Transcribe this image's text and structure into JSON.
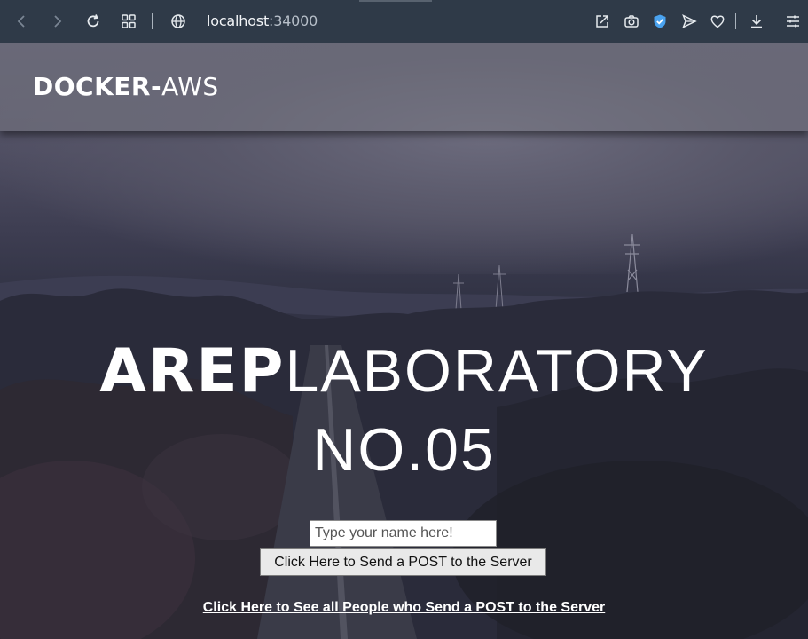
{
  "browser": {
    "url_host": "localhost",
    "url_port": ":34000",
    "icons": [
      "back-icon",
      "forward-icon",
      "reload-icon",
      "tabs-grid-icon",
      "globe-icon",
      "share-icon",
      "camera-icon",
      "shield-icon",
      "send-icon",
      "heart-icon",
      "download-icon",
      "menu-icon"
    ]
  },
  "header": {
    "brand_bold": "DOCKER-",
    "brand_light": "AWS"
  },
  "hero": {
    "title_bold": "AREP",
    "title_light": "LABORATORY",
    "subtitle": "NO.05"
  },
  "form": {
    "name_placeholder": "Type your name here!",
    "name_value": "",
    "post_button_label": "Click Here to Send a POST to the Server"
  },
  "link": {
    "people_label": "Click Here to See all People who Send a POST to the Server"
  }
}
